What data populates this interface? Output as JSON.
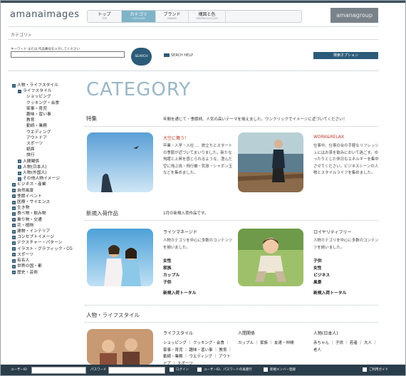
{
  "header": {
    "logo": "amanaimages",
    "group_logo": "amanagroup",
    "tabs": [
      {
        "label": "トップ",
        "sub": "TOP"
      },
      {
        "label": "カテゴリ",
        "sub": "CATEGORY"
      },
      {
        "label": "ブランド",
        "sub": "BRAND"
      },
      {
        "label": "構図と色",
        "sub": "GRAPHIC&COLOR"
      }
    ]
  },
  "breadcrumb": "カテゴリ>",
  "search": {
    "label": "キーワード または 作品番号を入力してください",
    "value": "",
    "button": "SEARCH",
    "help": "SERCH HELP",
    "option": "検索オプション"
  },
  "sidebar": {
    "items": [
      {
        "label": "人物・ライフスタイル",
        "level": 1,
        "box": "−"
      },
      {
        "label": "ライフスタイル",
        "level": 2,
        "box": "−"
      },
      {
        "label": "ショッピング",
        "level": 3
      },
      {
        "label": "クッキング・会食",
        "level": 3
      },
      {
        "label": "家事・育児",
        "level": 3
      },
      {
        "label": "趣味・習い事",
        "level": 3
      },
      {
        "label": "教育",
        "level": 3
      },
      {
        "label": "勤続・業務",
        "level": 3
      },
      {
        "label": "ウエディング",
        "level": 3
      },
      {
        "label": "アウトドア",
        "level": 3
      },
      {
        "label": "スポーツ",
        "level": 3
      },
      {
        "label": "紙面",
        "level": 3
      },
      {
        "label": "旅行",
        "level": 3
      },
      {
        "label": "人間関係",
        "level": 2,
        "box": "+"
      },
      {
        "label": "人物(日本人)",
        "level": 2,
        "box": "+"
      },
      {
        "label": "人物(外国人)",
        "level": 2,
        "box": "+"
      },
      {
        "label": "その他人物イメージ",
        "level": 2,
        "box": "+"
      },
      {
        "label": "ビジネス・産業",
        "level": 1,
        "box": "+"
      },
      {
        "label": "自然風景",
        "level": 1,
        "box": "+"
      },
      {
        "label": "季節イベント",
        "level": 1,
        "box": "+"
      },
      {
        "label": "医療・サイエンス",
        "level": 1,
        "box": "+"
      },
      {
        "label": "生き物",
        "level": 1,
        "box": "+"
      },
      {
        "label": "食べ物・飲み物",
        "level": 1,
        "box": "+"
      },
      {
        "label": "乗り物・交通",
        "level": 1,
        "box": "+"
      },
      {
        "label": "花・植物",
        "level": 1,
        "box": "+"
      },
      {
        "label": "建物・インテリア",
        "level": 1,
        "box": "+"
      },
      {
        "label": "コンセプトイメージ",
        "level": 1,
        "box": "+"
      },
      {
        "label": "テクスチャー・パターン",
        "level": 1,
        "box": "+"
      },
      {
        "label": "イラスト・グラフィック・CG",
        "level": 1,
        "box": "+"
      },
      {
        "label": "スポーツ",
        "level": 1,
        "box": "+"
      },
      {
        "label": "有名人",
        "level": 1,
        "box": "+"
      },
      {
        "label": "世界の国・都",
        "level": 1,
        "box": "+"
      },
      {
        "label": "歴史・芸術",
        "level": 1,
        "box": "+"
      }
    ]
  },
  "main": {
    "heading": "CATEGORY",
    "feature": {
      "title": "特集",
      "desc": "年間を通じて・季節柄、人気の高いテーマを揃えました。ワンクリックでイメージに近づいてください！",
      "cards": [
        {
          "title": "大空に舞う！",
          "desc": "卒業・入学・入社…、旅立ちとスタートの季節が近づいてまいりました。新たな飛躍と上昇を感じられるような、澄んだ空に飛ぶ鳥・飛行機・気球・シャボン玉などを集めました。"
        },
        {
          "title": "WORK&RELAX",
          "desc": "仕事中、仕事の合の手軽なリフレッシュにはお茶を飲みにおいて過ごす。ゆったりとした休日もエネルギーを集中させてください。ビジネスシーンの人物とスタイルライフを集めました。"
        }
      ]
    },
    "new": {
      "title": "新規入荷作品",
      "desc": "1月の新規入荷作品です。",
      "cards": [
        {
          "title": "ライツマネージド",
          "desc": "人物カテゴリを中心に多数のコンテンツを揃いました。",
          "links": [
            "女性",
            "家族",
            "カップル",
            "子供"
          ],
          "more": "新規入荷トータル"
        },
        {
          "title": "ロイヤリティフリー",
          "desc": "人物カテゴリを中心に多数のコンテンツを揃いました。",
          "links": [
            "子供",
            "女性",
            "ビジネス",
            "風景"
          ],
          "more": "新規入荷トータル"
        }
      ]
    },
    "people": {
      "title": "人物・ライフスタイル",
      "cols": [
        {
          "title": "ライフスタイル",
          "links": "ショッピング ｜ クッキング・会食 ｜ 家事・育児 ｜ 趣味・習い事 ｜ 教育 ｜ 勤続・業務 ｜ ウエディング ｜ アウトドア ｜ スポーツ"
        },
        {
          "title": "人間関係",
          "links": "カップル ｜ 家族 ｜ 友達・仲間"
        },
        {
          "title": "人物(日本人)",
          "links": "赤ちゃん ｜ 子供 ｜ 若者 ｜ 大人 ｜ 老人"
        }
      ]
    }
  },
  "bottom": {
    "user_id": "ユーザーID",
    "password": "パスワード",
    "login": "ログイン",
    "reissue": "ユーザーID、パスワードの再発行",
    "register": "新規メンバー登録",
    "guide": "ご利用ガイド"
  },
  "colors": {
    "accent": "#2c5b78",
    "heading": "#9ab7c6",
    "active_tab": "#7fb3c8",
    "bottom_bar": "#2a3d4a"
  }
}
